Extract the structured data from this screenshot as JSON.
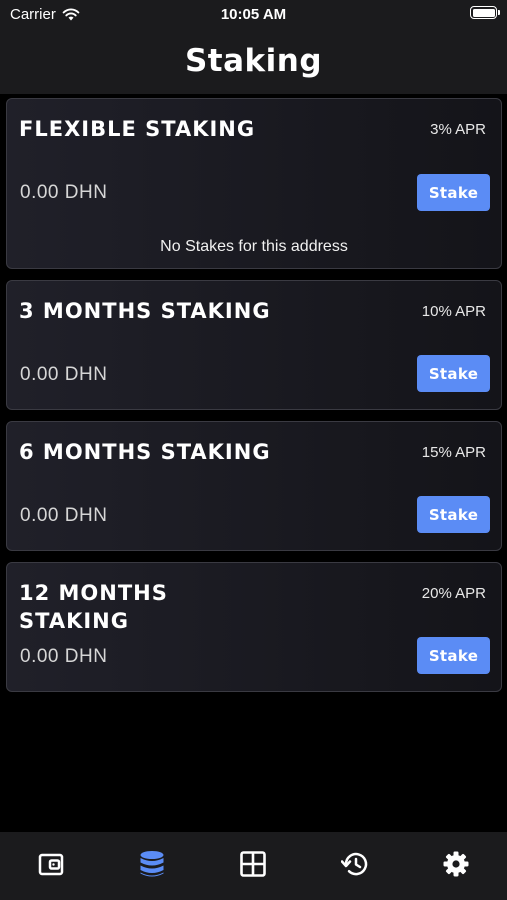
{
  "status_bar": {
    "carrier": "Carrier",
    "time": "10:05 AM"
  },
  "header": {
    "title": "Staking"
  },
  "plans": [
    {
      "title": "FLEXIBLE STAKING",
      "apr": "3% APR",
      "balance": "0.00 DHN",
      "button": "Stake",
      "empty_message": "No Stakes for this address"
    },
    {
      "title": "3 MONTHS STAKING",
      "apr": "10% APR",
      "balance": "0.00 DHN",
      "button": "Stake"
    },
    {
      "title": "6 MONTHS STAKING",
      "apr": "15% APR",
      "balance": "0.00 DHN",
      "button": "Stake"
    },
    {
      "title": "12 MONTHS STAKING",
      "apr": "20% APR",
      "balance": "0.00 DHN",
      "button": "Stake"
    }
  ],
  "tab_bar": {
    "tabs": [
      {
        "icon": "wallet-icon",
        "active": false
      },
      {
        "icon": "coins-stack-icon",
        "active": true
      },
      {
        "icon": "grid-icon",
        "active": false
      },
      {
        "icon": "history-icon",
        "active": false
      },
      {
        "icon": "gear-icon",
        "active": false
      }
    ],
    "active_color": "#5b8cf5",
    "inactive_color": "#ffffff"
  },
  "colors": {
    "accent": "#5b8cf5",
    "background": "#000000",
    "card": "#1a1a22"
  }
}
